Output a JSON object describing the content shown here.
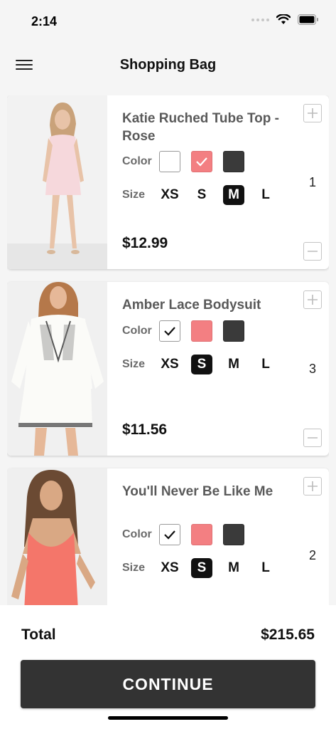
{
  "status_bar": {
    "time": "2:14"
  },
  "nav": {
    "title": "Shopping Bag",
    "menu_icon": "hamburger-menu-icon"
  },
  "labels": {
    "color": "Color",
    "size": "Size"
  },
  "colors": {
    "white": "#ffffff",
    "rose": "#f37f82",
    "dark": "#3a3a3a",
    "selected_size_bg": "#111111"
  },
  "items": [
    {
      "name": "Katie Ruched Tube Top - Rose",
      "price": "$12.99",
      "quantity": "1",
      "selected_color": "rose",
      "sizes": [
        "XS",
        "S",
        "M",
        "L"
      ],
      "selected_size": "M"
    },
    {
      "name": "Amber Lace Bodysuit",
      "price": "$11.56",
      "quantity": "3",
      "selected_color": "white",
      "sizes": [
        "XS",
        "S",
        "M",
        "L"
      ],
      "selected_size": "S"
    },
    {
      "name": "You'll Never Be Like Me",
      "price": "",
      "quantity": "2",
      "selected_color": "white",
      "sizes": [
        "XS",
        "S",
        "M",
        "L"
      ],
      "selected_size": "S"
    }
  ],
  "footer": {
    "total_label": "Total",
    "total_value": "$215.65",
    "continue_label": "CONTINUE"
  }
}
